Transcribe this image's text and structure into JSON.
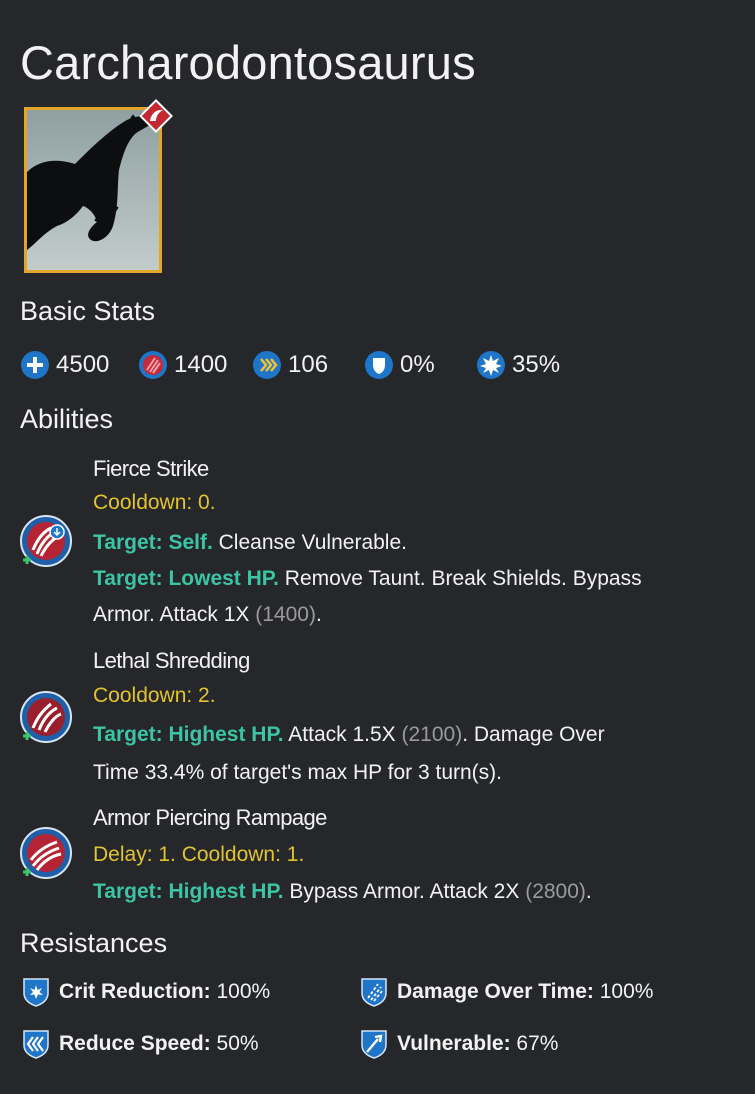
{
  "creature": {
    "name": "Carcharodontosaurus",
    "rarity_icon": "claw-icon"
  },
  "basic_stats": {
    "heading": "Basic Stats",
    "health": "4500",
    "damage": "1400",
    "speed": "106",
    "armor": "0%",
    "critical": "35%"
  },
  "abilities": {
    "heading": "Abilities",
    "items": [
      {
        "name": "Fierce Strike",
        "timing": "Cooldown: 0.",
        "lines": [
          {
            "target": "Target: Self.",
            "text": " Cleanse Vulnerable."
          },
          {
            "target": "Target: Lowest HP.",
            "text": " Remove Taunt. Break Shields. Bypass"
          },
          {
            "text": "Armor. Attack 1X ",
            "value": "(1400)",
            "end": "."
          }
        ]
      },
      {
        "name": "Lethal Shredding",
        "timing": "Cooldown: 2.",
        "lines": [
          {
            "target": "Target: Highest HP.",
            "text": " Attack 1.5X ",
            "value": "(2100)",
            "end": ". Damage Over"
          },
          {
            "text": "Time 33.4% of target's max HP for 3 turn(s)."
          }
        ]
      },
      {
        "name": "Armor Piercing Rampage",
        "timing": "Delay: 1. Cooldown: 1.",
        "lines": [
          {
            "target": "Target: Highest HP.",
            "text": " Bypass Armor. Attack 2X ",
            "value": "(2800)",
            "end": "."
          }
        ]
      }
    ]
  },
  "resistances": {
    "heading": "Resistances",
    "crit_reduction": {
      "label": "Crit Reduction:",
      "value": " 100%"
    },
    "damage_over_time": {
      "label": "Damage Over Time:",
      "value": " 100%"
    },
    "reduce_speed": {
      "label": "Reduce Speed:",
      "value": " 50%"
    },
    "vulnerable": {
      "label": "Vulnerable:",
      "value": " 67%"
    }
  },
  "colors": {
    "background": "#25272a",
    "cooldown": "#e1c431",
    "target": "#3cc4a4",
    "value": "#9a9a9a",
    "portrait_border": "#e3a62a",
    "icon_blue": "#1f75c7"
  }
}
